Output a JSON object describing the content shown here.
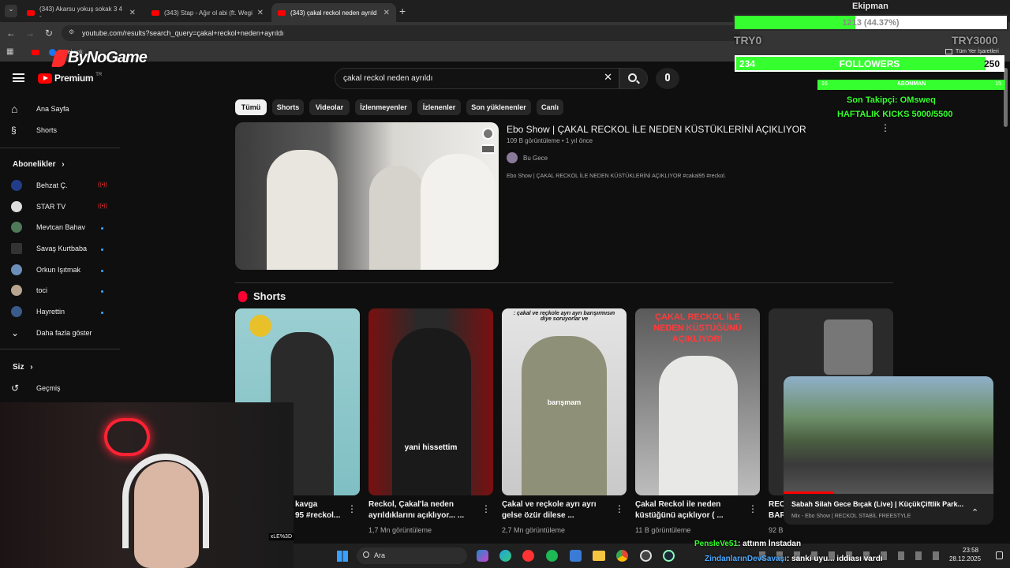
{
  "browser": {
    "tabs": [
      {
        "label": "(343) Akarsu yokuş sokak 3 4 -",
        "active": false
      },
      {
        "label": "(343) Stap - Ağır ol abi (ft. Wegi",
        "active": false
      },
      {
        "label": "(343) çakal reckol neden ayrıldı",
        "active": true
      }
    ],
    "url": "youtube.com/results?search_query=çakal+reckol+neden+ayrıldı",
    "bookmark_facebook": "Facebook",
    "bookmark_all": "Tüm Yer İşaretleri"
  },
  "header": {
    "brand": "Premium",
    "brand_sup": "TR",
    "search_value": "çakal reckol neden ayrıldı"
  },
  "sidebar": {
    "home": "Ana Sayfa",
    "shorts": "Shorts",
    "subs_heading": "Abonelikler",
    "subs": [
      {
        "label": "Behzat Ç.",
        "live": true
      },
      {
        "label": "STAR TV",
        "live": true
      },
      {
        "label": "Mevtcan Bahav",
        "live": false
      },
      {
        "label": "Savaş Kurtbaba",
        "live": false
      },
      {
        "label": "Orkun Işıtmak",
        "live": false
      },
      {
        "label": "toci",
        "live": false
      },
      {
        "label": "Hayrettin",
        "live": false
      }
    ],
    "more": "Daha fazla göster",
    "you_heading": "Siz",
    "history": "Geçmiş"
  },
  "chips": [
    "Tümü",
    "Shorts",
    "Videolar",
    "İzlenmeyenler",
    "İzlenenler",
    "Son yüklenenler",
    "Canlı"
  ],
  "top_result": {
    "title": "Ebo Show | ÇAKAL RECKOL İLE NEDEN KÜSTÜKLERİNİ AÇIKLIYOR",
    "meta": "109 B görüntüleme • 1 yıl önce",
    "channel": "Bu Gece",
    "description": "Ebo Show | ÇAKAL RECKOL İLE NEDEN KÜSTÜKLERİNİ AÇIKLIYOR #cakal95 #reckol."
  },
  "shorts_section": {
    "heading": "Shorts",
    "items": [
      {
        "title_l1": "kavga",
        "title_l2": "95 #reckol...",
        "views": ""
      },
      {
        "title_l1": "Reckol, Çakal'la neden",
        "title_l2": "ayrıldıklarını açıklıyor... ...",
        "views": "1,7 Mn görüntüleme",
        "caption": "yani hissettim"
      },
      {
        "title_l1": "Çakal ve reçkole ayrı ayrı",
        "title_l2": "gelse özür dilese ...",
        "views": "2,7 Mn görüntüleme",
        "caption": "barışmam",
        "top_caption": ": çakal ve reçkole ayrı ayrı barışırmısın diye soruyorlar ve"
      },
      {
        "title_l1": "Çakal Reckol ile neden",
        "title_l2": "küstüğünü açıklıyor ( ...",
        "views": "11 B görüntüleme",
        "top_caption": "ÇAKAL RECKOL İLE NEDEN KÜSTÜĞÜNÜ AÇIKLIYOR!"
      },
      {
        "title_l1": "REC",
        "title_l2": "BAR",
        "views": "92 B"
      }
    ]
  },
  "miniplayer": {
    "title": "Sabah Silah Gece Bıçak (Live) | KüçükÇiftlik Park...",
    "subtitle": "Mix - Ebo Show | RECKOL STABİL FREESTYLE"
  },
  "stream_overlay": {
    "brand": "ByNoGame",
    "goal_text": "1213 (44.37%)",
    "goal_left": "TRY0",
    "goal_right": "TRY3000",
    "goal_fraction": 0.4437,
    "followers_current": "234",
    "followers_label": "FOLLOWERS",
    "followers_target": "250",
    "followers_fraction": 0.936,
    "sub_left": "16",
    "sub_label": "ABONMAN",
    "sub_right": "15",
    "last_follower": "Son Takipçi: OMsweq",
    "weekly_kicks": "HAFTALIK KICKS 5000/5500",
    "top_name": "Ekipman",
    "chat_1_user": "PensleVe51",
    "chat_1_text": ": attınm İnstadan",
    "chat_2_user": "ZindanlarınDevSavaşı",
    "chat_2_text": ": sanki uyu... iddiası vardı",
    "tag": "xLE%3D"
  },
  "taskbar": {
    "search_placeholder": "Ara",
    "time": "23:58",
    "date": "28.12.2025"
  },
  "colors": {
    "yt_red": "#ff0000",
    "accent_blue": "#3ea6ff",
    "overlay_green": "#36ff2f"
  }
}
